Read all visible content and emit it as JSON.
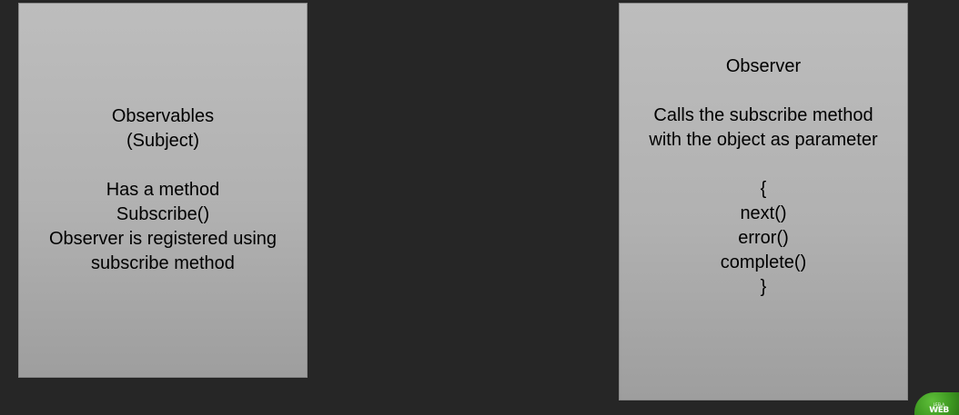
{
  "left_box": {
    "lines": [
      "Observables",
      "(Subject)",
      "",
      "Has a method",
      "Subscribe()",
      "Observer is registered using",
      "subscribe method"
    ]
  },
  "right_box": {
    "lines": [
      "Observer",
      "",
      "Calls the subscribe method",
      "with the object as parameter",
      "",
      "{",
      "next()",
      "error()",
      "complete()",
      "}"
    ]
  },
  "logo": {
    "small_text": "LEELA",
    "big_text": "WEB"
  }
}
